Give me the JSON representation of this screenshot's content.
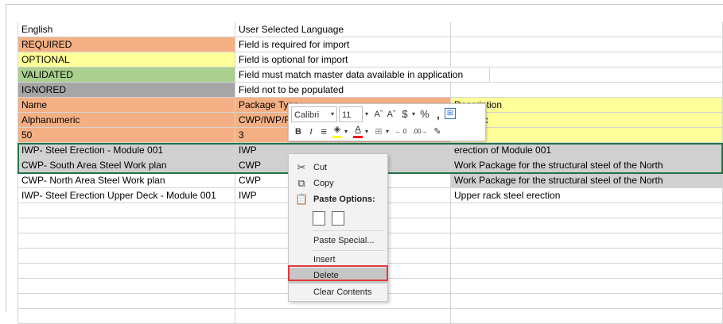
{
  "rows": [
    {
      "c1": "English",
      "c2": "User Selected Language",
      "c3": "",
      "bg1": "#ffffff",
      "bg2": "#ffffff",
      "bg3": "#ffffff"
    },
    {
      "c1": "REQUIRED",
      "c2": "Field is required for import",
      "c3": "",
      "bg1": "#f4b084",
      "bg2": "#ffffff",
      "bg3": "#ffffff"
    },
    {
      "c1": "OPTIONAL",
      "c2": "Field is optional for import",
      "c3": "",
      "bg1": "#ffff99",
      "bg2": "#ffffff",
      "bg3": "#ffffff"
    },
    {
      "c1": "VALIDATED",
      "c2": "Field must match master data available in application",
      "c3": "",
      "bg1": "#a9d08e",
      "bg2": "#ffffff",
      "bg3": "#ffffff"
    },
    {
      "c1": "IGNORED",
      "c2": "Field not to be populated",
      "c3": "",
      "bg1": "#a6a6a6",
      "bg2": "#ffffff",
      "bg3": "#ffffff"
    },
    {
      "c1": "Name",
      "c2": "Package Type",
      "c3": "Description",
      "bg1": "#f4b084",
      "bg2": "#f4b084",
      "bg3": "#ffff99"
    },
    {
      "c1": "Alphanumeric",
      "c2": "CWP/IWP/F",
      "c3": "numeric",
      "bg1": "#f4b084",
      "bg2": "#f4b084",
      "bg3": "#ffff99"
    },
    {
      "c1": "50",
      "c2": "3",
      "c3": "",
      "bg1": "#f4b084",
      "bg2": "#f4b084",
      "bg3": "#ffff99"
    },
    {
      "c1": "IWP- Steel Erection - Module 001",
      "c2": "IWP",
      "c3": "erection of Module 001",
      "bg1": "#d0d0d0",
      "bg2": "#d0d0d0",
      "bg3": "#d0d0d0"
    },
    {
      "c1": "CWP- South Area Steel Work plan",
      "c2": "CWP",
      "c3": "Work Package for the structural steel of the North",
      "bg1": "#d0d0d0",
      "bg2": "#d0d0d0",
      "bg3": "#d0d0d0"
    },
    {
      "c1": "CWP- North Area Steel Work plan",
      "c2": "CWP",
      "c3": "Work Package for the structural steel of the North",
      "bg1": "#ffffff",
      "bg2": "#ffffff",
      "bg3": "#d0d0d0"
    },
    {
      "c1": "IWP- Steel Erection Upper Deck - Module 001",
      "c2": "IWP",
      "c3": "Upper rack steel erection",
      "bg1": "#ffffff",
      "bg2": "#ffffff",
      "bg3": "#ffffff"
    },
    {
      "c1": "",
      "c2": "",
      "c3": "",
      "bg1": "#ffffff",
      "bg2": "#ffffff",
      "bg3": "#ffffff"
    },
    {
      "c1": "",
      "c2": "",
      "c3": "",
      "bg1": "#ffffff",
      "bg2": "#ffffff",
      "bg3": "#ffffff"
    },
    {
      "c1": "",
      "c2": "",
      "c3": "",
      "bg1": "#ffffff",
      "bg2": "#ffffff",
      "bg3": "#ffffff"
    },
    {
      "c1": "",
      "c2": "",
      "c3": "",
      "bg1": "#ffffff",
      "bg2": "#ffffff",
      "bg3": "#ffffff"
    },
    {
      "c1": "",
      "c2": "",
      "c3": "",
      "bg1": "#ffffff",
      "bg2": "#ffffff",
      "bg3": "#ffffff"
    },
    {
      "c1": "",
      "c2": "",
      "c3": "",
      "bg1": "#ffffff",
      "bg2": "#ffffff",
      "bg3": "#ffffff"
    },
    {
      "c1": "",
      "c2": "",
      "c3": "",
      "bg1": "#ffffff",
      "bg2": "#ffffff",
      "bg3": "#ffffff"
    },
    {
      "c1": "",
      "c2": "",
      "c3": "",
      "bg1": "#ffffff",
      "bg2": "#ffffff",
      "bg3": "#ffffff"
    }
  ],
  "mini_toolbar": {
    "font_name": "Calibri",
    "font_size": "11",
    "grow_font": "Aˆ",
    "shrink_font": "Aˇ",
    "currency": "$",
    "percent": "%",
    "comma": "̹",
    "bold": "B",
    "italic": "I",
    "align": "≡",
    "font_color": "A",
    "inc_decimal": "←.0",
    "dec_decimal": ".00→"
  },
  "context_menu": {
    "cut": "Cut",
    "copy": "Copy",
    "paste_options": "Paste Options:",
    "paste_special": "Paste Special...",
    "insert": "Insert",
    "delete": "Delete",
    "clear_contents": "Clear Contents"
  },
  "colors": {
    "required": "#f4b084",
    "optional": "#ffff99",
    "validated": "#a9d08e",
    "ignored": "#a6a6a6",
    "selected_row": "#d0d0d0",
    "highlight_box": "#e0393e"
  }
}
